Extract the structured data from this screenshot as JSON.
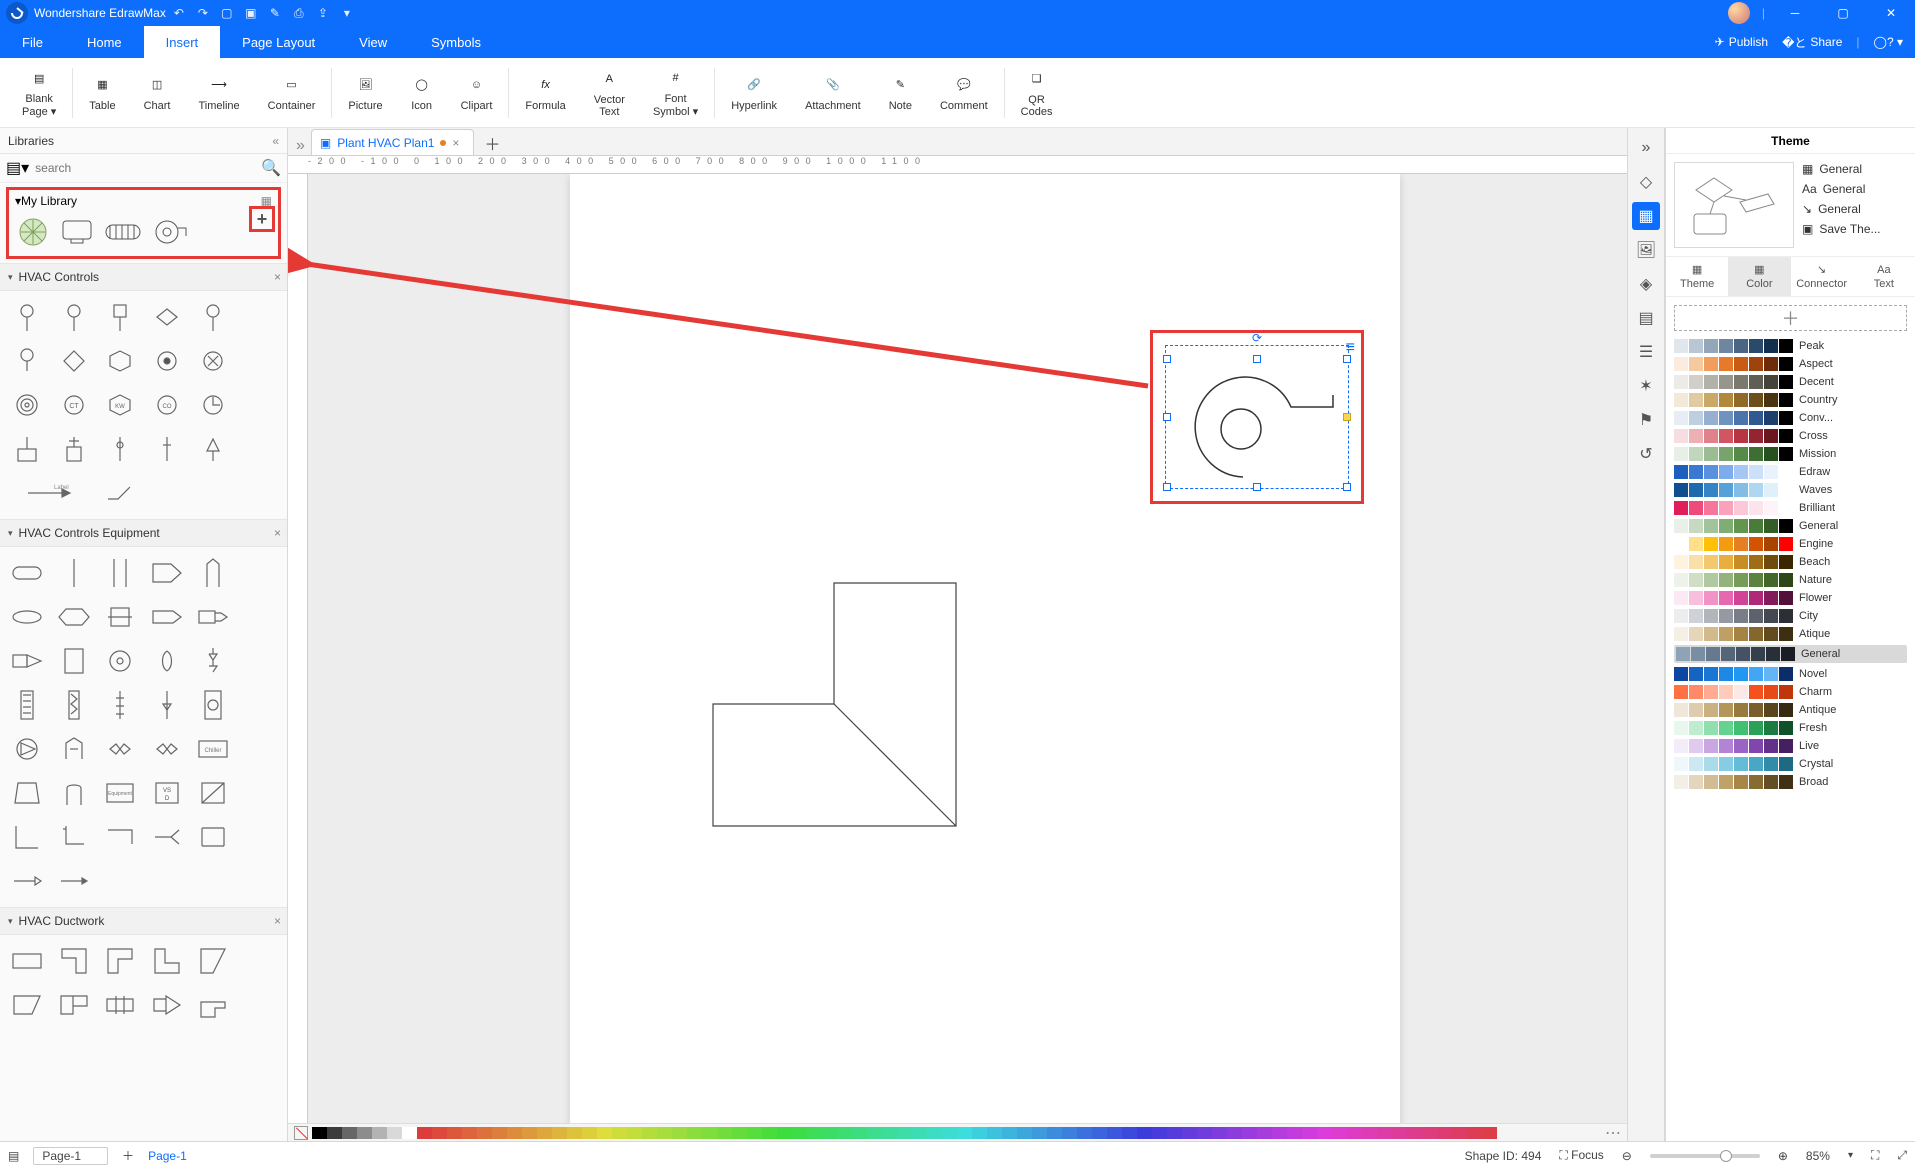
{
  "app": {
    "title": "Wondershare EdrawMax"
  },
  "menu": {
    "file": "File",
    "home": "Home",
    "insert": "Insert",
    "page_layout": "Page Layout",
    "view": "View",
    "symbols": "Symbols",
    "publish": "Publish",
    "share": "Share"
  },
  "ribbon": {
    "blank_page": "Blank\nPage ▾",
    "table": "Table",
    "chart": "Chart",
    "timeline": "Timeline",
    "container": "Container",
    "picture": "Picture",
    "icon": "Icon",
    "clipart": "Clipart",
    "formula": "Formula",
    "vector_text": "Vector\nText",
    "font_symbol": "Font\nSymbol ▾",
    "hyperlink": "Hyperlink",
    "attachment": "Attachment",
    "note": "Note",
    "comment": "Comment",
    "qr": "QR\nCodes"
  },
  "libraries": {
    "title": "Libraries",
    "search_placeholder": "search",
    "my_library": "My Library",
    "sections": {
      "hvac_controls": "HVAC Controls",
      "hvac_equip": "HVAC Controls Equipment",
      "hvac_duct": "HVAC Ductwork"
    }
  },
  "doc": {
    "tab_title": "Plant HVAC Plan1"
  },
  "right_rail": {
    "items": [
      "expand",
      "style",
      "image",
      "layers",
      "page",
      "outline",
      "random",
      "find",
      "history"
    ]
  },
  "theme": {
    "title": "Theme",
    "quick": {
      "general1": "General",
      "general2": "General",
      "general3": "General",
      "save": "Save The..."
    },
    "tabs": {
      "theme": "Theme",
      "color": "Color",
      "connector": "Connector",
      "text": "Text"
    },
    "schemes": [
      {
        "name": "Peak",
        "colors": [
          "#dfe6ec",
          "#b9c6d3",
          "#93a6ba",
          "#6e869f",
          "#4a6684",
          "#2a4a6b",
          "#122f4d",
          "#000"
        ]
      },
      {
        "name": "Aspect",
        "colors": [
          "#fcece0",
          "#f6c9a0",
          "#ef9f5b",
          "#e7792a",
          "#c95b13",
          "#9f430d",
          "#6e2d08",
          "#000"
        ]
      },
      {
        "name": "Decent",
        "colors": [
          "#ecebe8",
          "#d0cfc9",
          "#b3b2aa",
          "#97958c",
          "#7b786e",
          "#605d54",
          "#46433b",
          "#000"
        ]
      },
      {
        "name": "Country",
        "colors": [
          "#f2e9d8",
          "#e0caa1",
          "#caa968",
          "#b2883b",
          "#8f6a28",
          "#6c4f1b",
          "#4a3510",
          "#000"
        ]
      },
      {
        "name": "Conv...",
        "colors": [
          "#e7edf4",
          "#bfcfe2",
          "#97b0d0",
          "#7092be",
          "#4a74ab",
          "#2f598f",
          "#1c3f6d",
          "#000"
        ]
      },
      {
        "name": "Cross",
        "colors": [
          "#f6dee0",
          "#ecb0b5",
          "#e0828b",
          "#d25563",
          "#b93544",
          "#932431",
          "#6b1720",
          "#000"
        ]
      },
      {
        "name": "Mission",
        "colors": [
          "#e8efe6",
          "#c2d6bd",
          "#9cbd94",
          "#77a46c",
          "#568a48",
          "#3d6f32",
          "#285120",
          "#000"
        ]
      },
      {
        "name": "Edraw",
        "colors": [
          "#1d5fbf",
          "#3a78d1",
          "#5a91df",
          "#7eabeb",
          "#a6c6f3",
          "#cde0fa",
          "#eaf2fd",
          "#fff"
        ]
      },
      {
        "name": "Waves",
        "colors": [
          "#104f8f",
          "#1f6aad",
          "#3485c5",
          "#56a1d8",
          "#81bde6",
          "#b0d7f1",
          "#def0fa",
          "#fff"
        ]
      },
      {
        "name": "Brilliant",
        "colors": [
          "#e01e5a",
          "#ee4a7b",
          "#f5769b",
          "#faa2bb",
          "#fcc7d6",
          "#fde3ec",
          "#fef3f7",
          "#fff"
        ]
      },
      {
        "name": "General",
        "colors": [
          "#e9f0e7",
          "#c6dac1",
          "#a3c39a",
          "#80ad73",
          "#62964f",
          "#497c39",
          "#335e27",
          "#000"
        ]
      },
      {
        "name": "Engine",
        "colors": [
          "#fff",
          "#ffe08a",
          "#ffc107",
          "#f39c12",
          "#e67e22",
          "#d35400",
          "#a84300",
          "#f00"
        ]
      },
      {
        "name": "Beach",
        "colors": [
          "#fdf3df",
          "#f9e0a8",
          "#f3c96f",
          "#e9ae3e",
          "#c98e23",
          "#9e6d16",
          "#6f4b0c",
          "#3b2600"
        ]
      },
      {
        "name": "Nature",
        "colors": [
          "#eef3ea",
          "#d0dec6",
          "#b1c9a1",
          "#92b37c",
          "#759d59",
          "#5b833f",
          "#43662b",
          "#2d4719"
        ]
      },
      {
        "name": "Flower",
        "colors": [
          "#fde9f3",
          "#f8bedd",
          "#f193c6",
          "#e768af",
          "#d24296",
          "#ae2a79",
          "#821b5a",
          "#53103a"
        ]
      },
      {
        "name": "City",
        "colors": [
          "#ecedef",
          "#cfd1d6",
          "#b2b5bc",
          "#9599a2",
          "#787d88",
          "#5d626d",
          "#444851",
          "#2c2f35"
        ]
      },
      {
        "name": "Atique",
        "colors": [
          "#f5efe4",
          "#e5d5b9",
          "#d3ba8d",
          "#bf9f63",
          "#a58342",
          "#85672e",
          "#624b1e",
          "#3e2f11"
        ]
      },
      {
        "name": "General2",
        "colors": [
          "#8fa3b8",
          "#7a8ea3",
          "#66798e",
          "#546578",
          "#445263",
          "#35404d",
          "#272f38",
          "#1a1e24"
        ],
        "active": true,
        "label": "General"
      },
      {
        "name": "Novel",
        "colors": [
          "#0d47a1",
          "#1565c0",
          "#1976d2",
          "#1e88e5",
          "#2196f3",
          "#42a5f5",
          "#64b5f6",
          "#0b2e6b"
        ]
      },
      {
        "name": "Charm",
        "colors": [
          "#ff7043",
          "#ff8a65",
          "#ffab91",
          "#ffccbc",
          "#fbe9e7",
          "#f4511e",
          "#e64a19",
          "#bf360c"
        ]
      },
      {
        "name": "Antique",
        "colors": [
          "#efe7d8",
          "#ddccad",
          "#c9b182",
          "#b4955a",
          "#997a3e",
          "#7a5f2c",
          "#59441d",
          "#382a10"
        ]
      },
      {
        "name": "Fresh",
        "colors": [
          "#e8f8ef",
          "#bdeccf",
          "#91dfaf",
          "#65d28f",
          "#3fc171",
          "#2aa058",
          "#1b7b41",
          "#0f522a"
        ]
      },
      {
        "name": "Live",
        "colors": [
          "#f5ecf9",
          "#e0caee",
          "#caa7e2",
          "#b384d5",
          "#9b63c6",
          "#8046ae",
          "#63318a",
          "#451f61"
        ]
      },
      {
        "name": "Crystal",
        "colors": [
          "#eef7fb",
          "#cce9f3",
          "#a9dbeb",
          "#86cce2",
          "#65bcd8",
          "#49a6c5",
          "#318ba9",
          "#1e6a84"
        ]
      },
      {
        "name": "Broad",
        "colors": [
          "#f4efe6",
          "#e3d6bd",
          "#d1bc93",
          "#bfa26a",
          "#a78647",
          "#876b33",
          "#644e23",
          "#403114"
        ]
      }
    ]
  },
  "status": {
    "page_sel": "Page-1",
    "page_link": "Page-1",
    "shape_id_label": "Shape ID:",
    "shape_id": "494",
    "focus": "Focus",
    "zoom": "85%"
  }
}
